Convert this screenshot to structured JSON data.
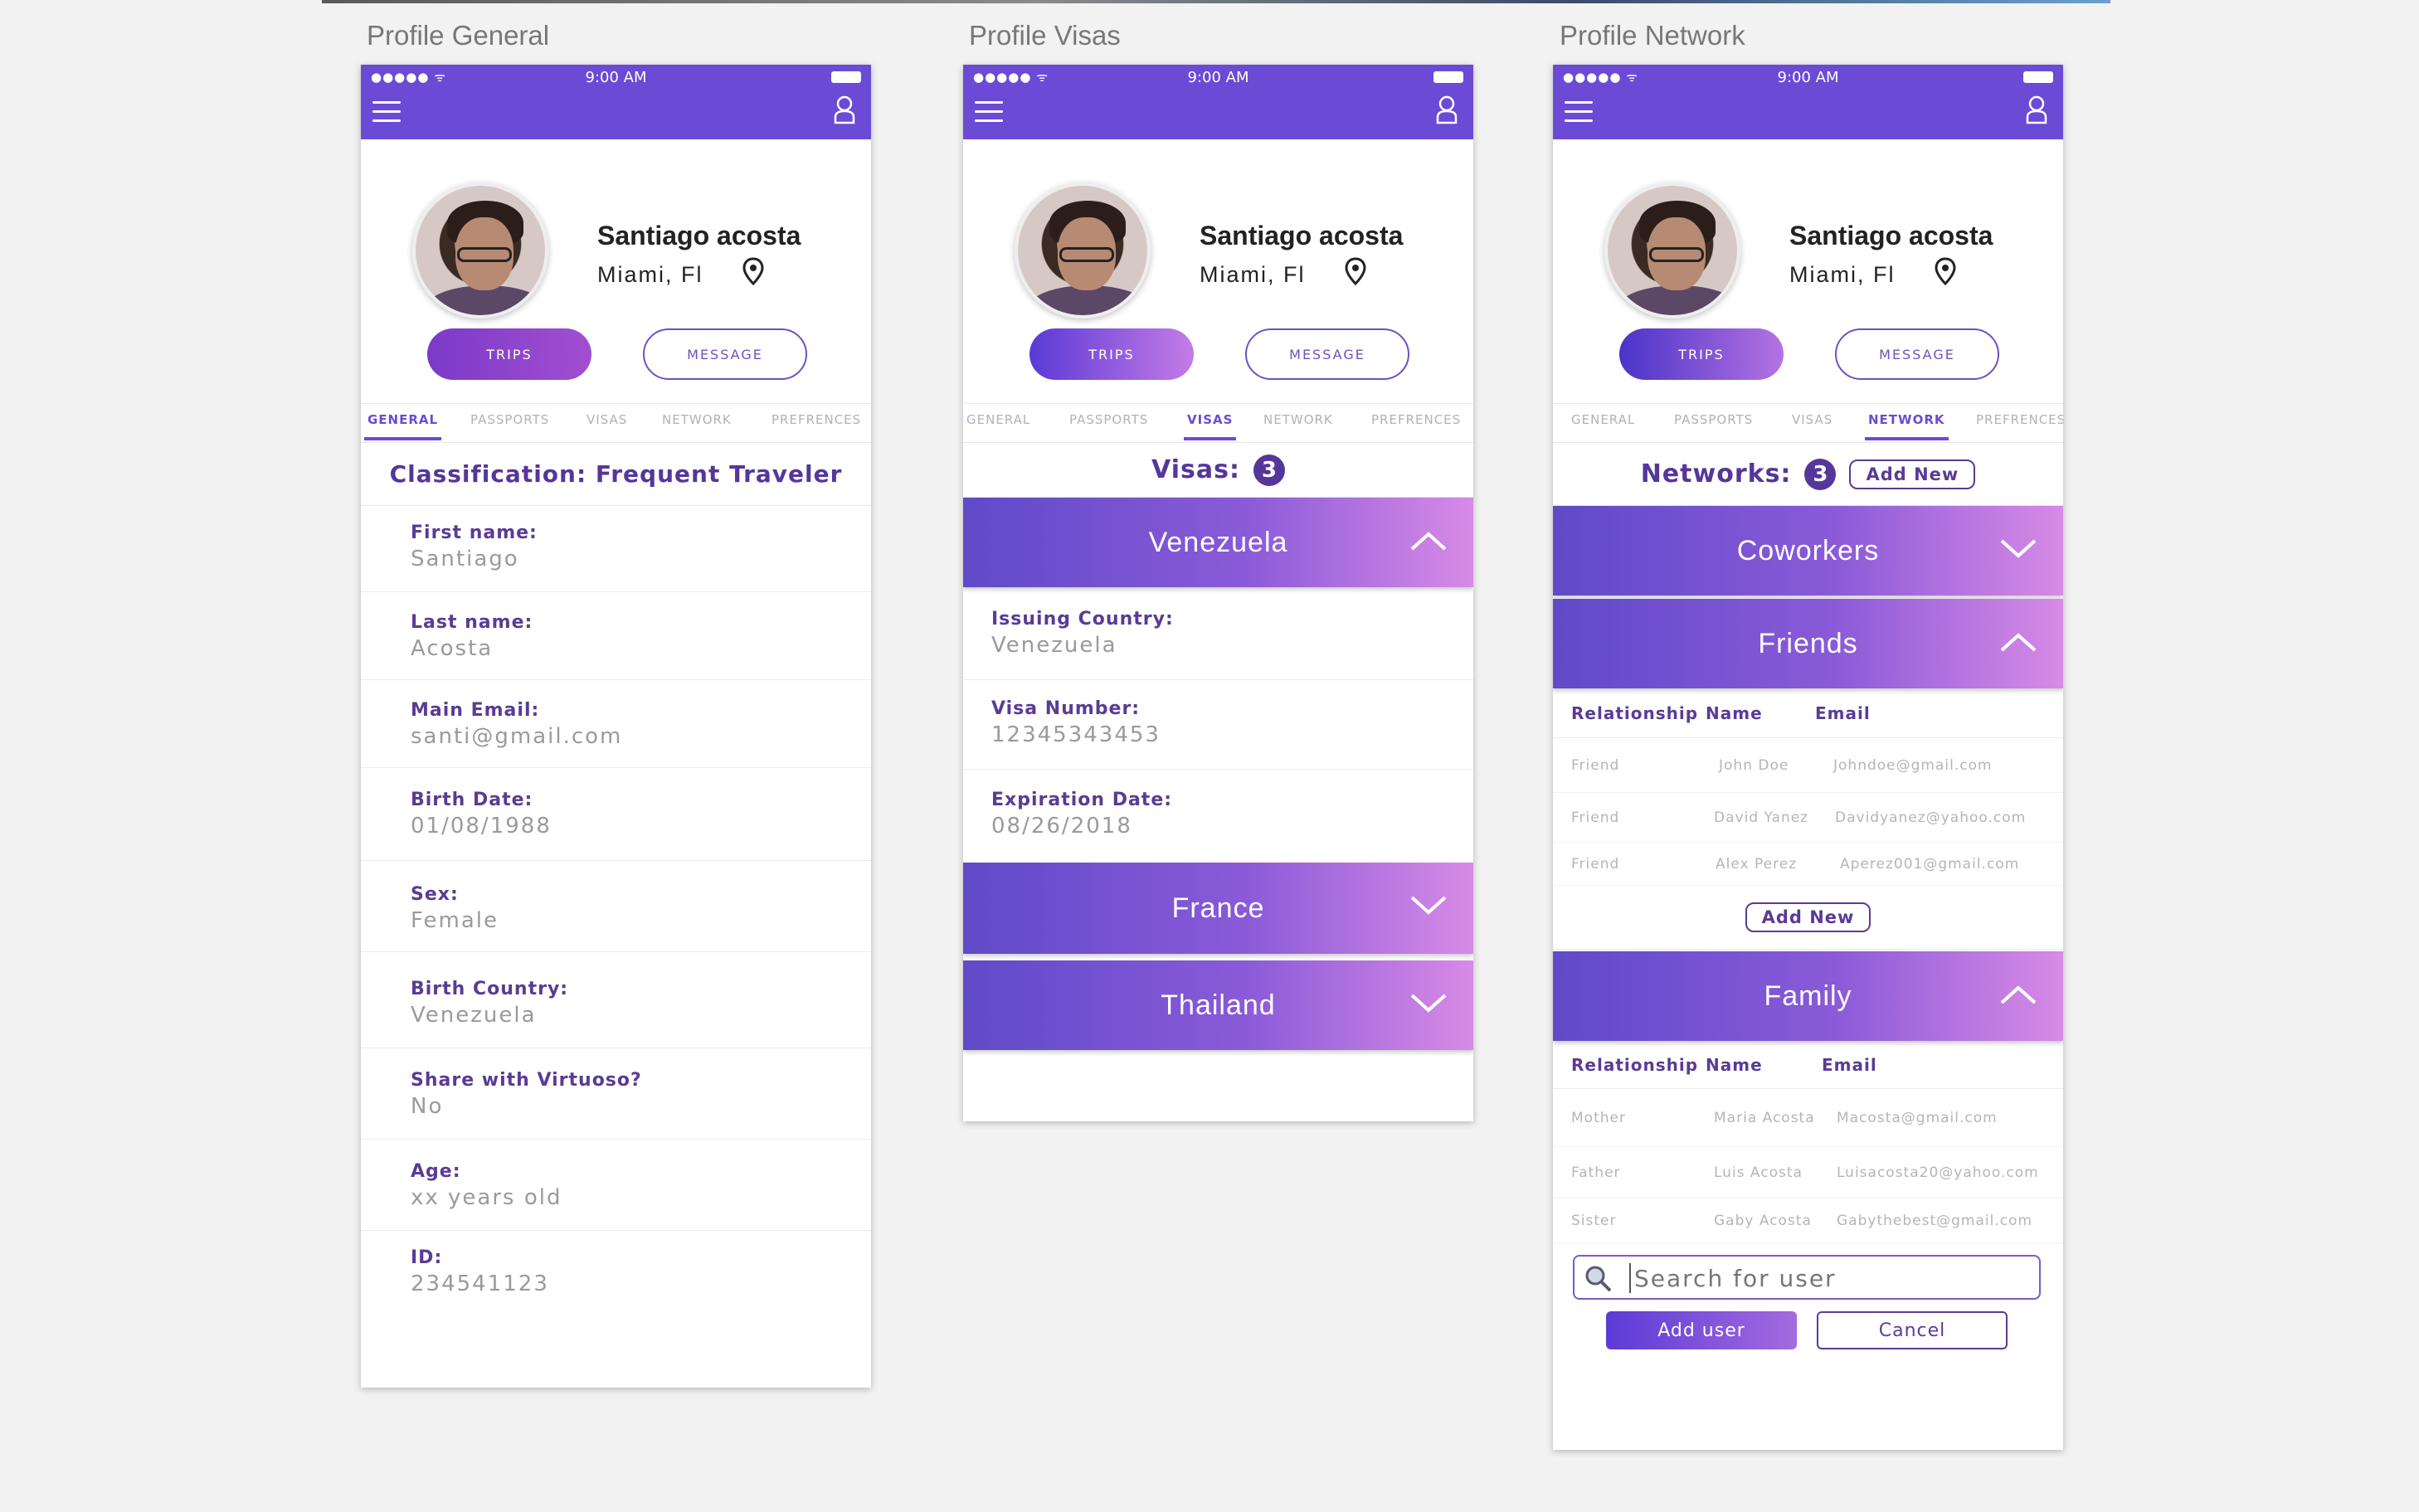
{
  "artboards": {
    "general_label": "Profile General",
    "visas_label": "Profile Visas",
    "network_label": "Profile Network"
  },
  "status_bar": {
    "signal": "●●●●● ᯤ",
    "time": "9:00 AM"
  },
  "profile": {
    "name": "Santiago acosta",
    "location": "Miami, Fl"
  },
  "buttons": {
    "trips": "TRIPS",
    "message": "MESSAGE"
  },
  "tabs": {
    "general": "GENERAL",
    "passports": "PASSPORTS",
    "visas": "VISAS",
    "network": "NETWORK",
    "preferences": "PREFRENCES"
  },
  "general": {
    "classification": "Classification: Frequent Traveler",
    "fields": [
      {
        "label": "First name:",
        "value": "Santiago"
      },
      {
        "label": "Last name:",
        "value": "Acosta"
      },
      {
        "label": "Main Email:",
        "value": "santi@gmail.com"
      },
      {
        "label": "Birth Date:",
        "value": "01/08/1988"
      },
      {
        "label": "Sex:",
        "value": "Female"
      },
      {
        "label": "Birth Country:",
        "value": "Venezuela"
      },
      {
        "label": "Share with Virtuoso?",
        "value": "No"
      },
      {
        "label": "Age:",
        "value": "xx years old"
      },
      {
        "label": "ID:",
        "value": "234541123"
      }
    ]
  },
  "visas": {
    "count_label": "Visas:",
    "count": "3",
    "venezuela": {
      "title": "Venezuela",
      "fields": [
        {
          "label": "Issuing Country:",
          "value": "Venezuela"
        },
        {
          "label": "Visa Number:",
          "value": "12345343453"
        },
        {
          "label": "Expiration Date:",
          "value": "08/26/2018"
        }
      ]
    },
    "france": "France",
    "thailand": "Thailand"
  },
  "network": {
    "count_label": "Networks:",
    "count": "3",
    "add_new": "Add New",
    "coworkers": "Coworkers",
    "friends": {
      "title": "Friends",
      "headers": {
        "relationship": "Relationship",
        "name": "Name",
        "email": "Email"
      },
      "rows": [
        {
          "relationship": "Friend",
          "name": "John Doe",
          "email": "Johndoe@gmail.com"
        },
        {
          "relationship": "Friend",
          "name": "David Yanez",
          "email": "Davidyanez@yahoo.com"
        },
        {
          "relationship": "Friend",
          "name": "Alex Perez",
          "email": "Aperez001@gmail.com"
        }
      ],
      "add_new": "Add New"
    },
    "family": {
      "title": "Family",
      "headers": {
        "relationship": "Relationship",
        "name": "Name",
        "email": "Email"
      },
      "rows": [
        {
          "relationship": "Mother",
          "name": "Maria Acosta",
          "email": "Macosta@gmail.com"
        },
        {
          "relationship": "Father",
          "name": "Luis Acosta",
          "email": "Luisacosta20@yahoo.com"
        },
        {
          "relationship": "Sister",
          "name": "Gaby Acosta",
          "email": "Gabythebest@gmail.com"
        }
      ]
    },
    "search_placeholder": "Search for user",
    "add_user": "Add user",
    "cancel": "Cancel"
  },
  "colors": {
    "header": "#6b4ad6",
    "accent": "#55369a",
    "gradient_start": "#5f4ac8",
    "gradient_end": "#d88ae6"
  },
  "icons": [
    "hamburger-menu-icon",
    "user-icon",
    "location-pin-icon",
    "chevron-up-icon",
    "chevron-down-icon",
    "search-icon"
  ]
}
